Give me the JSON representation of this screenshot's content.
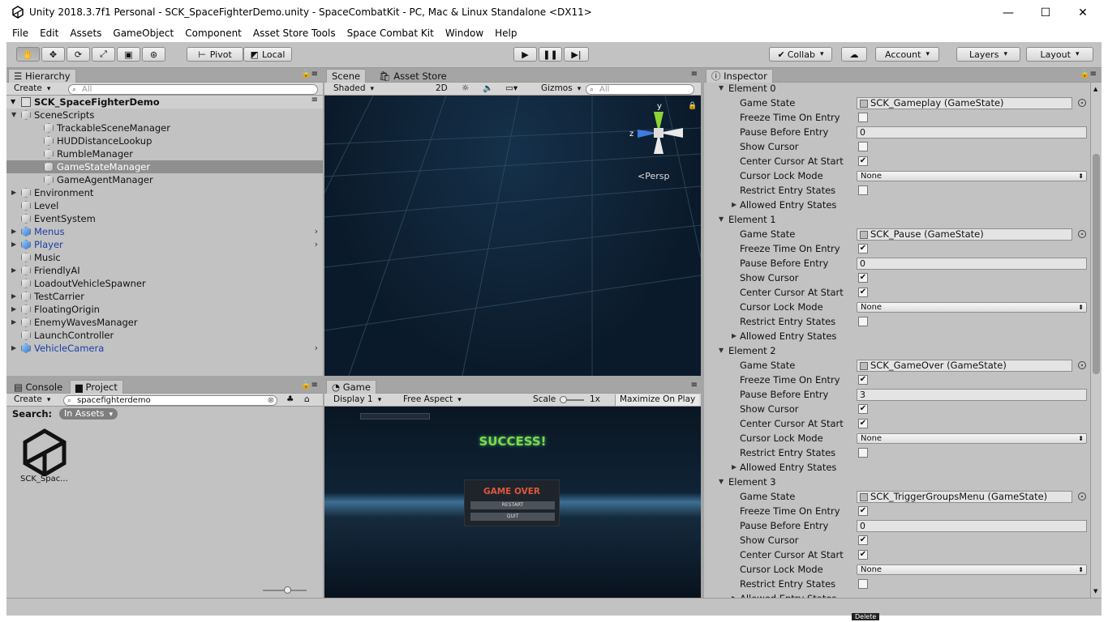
{
  "window": {
    "title": "Unity 2018.3.7f1 Personal - SCK_SpaceFighterDemo.unity - SpaceCombatKit - PC, Mac & Linux Standalone <DX11>",
    "minimize": "—",
    "maximize": "☐",
    "close": "✕"
  },
  "menu": [
    "File",
    "Edit",
    "Assets",
    "GameObject",
    "Component",
    "Asset Store Tools",
    "Space Combat Kit",
    "Window",
    "Help"
  ],
  "toolbar": {
    "pivot": "Pivot",
    "local": "Local",
    "collab": "Collab",
    "account": "Account",
    "layers": "Layers",
    "layout": "Layout"
  },
  "hierarchy": {
    "tab": "Hierarchy",
    "create": "Create",
    "search_placeholder": "All",
    "scene": "SCK_SpaceFighterDemo",
    "items": [
      {
        "label": "SceneScripts",
        "depth": 1,
        "expander": "open",
        "blue": false,
        "selected": false
      },
      {
        "label": "TrackableSceneManager",
        "depth": 2,
        "expander": "",
        "blue": false,
        "selected": false
      },
      {
        "label": "HUDDistanceLookup",
        "depth": 2,
        "expander": "",
        "blue": false,
        "selected": false
      },
      {
        "label": "RumbleManager",
        "depth": 2,
        "expander": "",
        "blue": false,
        "selected": false
      },
      {
        "label": "GameStateManager",
        "depth": 2,
        "expander": "",
        "blue": false,
        "selected": true
      },
      {
        "label": "GameAgentManager",
        "depth": 2,
        "expander": "",
        "blue": false,
        "selected": false
      },
      {
        "label": "Environment",
        "depth": 1,
        "expander": "closed",
        "blue": false,
        "selected": false
      },
      {
        "label": "Level",
        "depth": 1,
        "expander": "",
        "blue": false,
        "selected": false
      },
      {
        "label": "EventSystem",
        "depth": 1,
        "expander": "",
        "blue": false,
        "selected": false
      },
      {
        "label": "Menus",
        "depth": 1,
        "expander": "closed",
        "blue": true,
        "selected": false
      },
      {
        "label": "Player",
        "depth": 1,
        "expander": "closed",
        "blue": true,
        "selected": false
      },
      {
        "label": "Music",
        "depth": 1,
        "expander": "",
        "blue": false,
        "selected": false
      },
      {
        "label": "FriendlyAI",
        "depth": 1,
        "expander": "closed",
        "blue": false,
        "selected": false
      },
      {
        "label": "LoadoutVehicleSpawner",
        "depth": 1,
        "expander": "",
        "blue": false,
        "selected": false
      },
      {
        "label": "TestCarrier",
        "depth": 1,
        "expander": "closed",
        "blue": false,
        "selected": false
      },
      {
        "label": "FloatingOrigin",
        "depth": 1,
        "expander": "closed",
        "blue": false,
        "selected": false
      },
      {
        "label": "EnemyWavesManager",
        "depth": 1,
        "expander": "closed",
        "blue": false,
        "selected": false
      },
      {
        "label": "LaunchController",
        "depth": 1,
        "expander": "",
        "blue": false,
        "selected": false
      },
      {
        "label": "VehicleCamera",
        "depth": 1,
        "expander": "closed",
        "blue": true,
        "selected": false
      }
    ]
  },
  "scene": {
    "tab_scene": "Scene",
    "tab_asset_store": "Asset Store",
    "shaded": "Shaded",
    "mode_2d": "2D",
    "gizmos": "Gizmos",
    "search_placeholder": "All",
    "persp": "Persp",
    "axis_y": "y",
    "axis_z": "z"
  },
  "project": {
    "tab_console": "Console",
    "tab_project": "Project",
    "create": "Create",
    "search_value": "spacefighterdemo",
    "search_label": "Search:",
    "scope": "In Assets",
    "asset_name": "SCK_Spac..."
  },
  "game": {
    "tab": "Game",
    "display": "Display 1",
    "aspect": "Free Aspect",
    "scale_label": "Scale",
    "scale_value": "1x",
    "maximize": "Maximize On Play",
    "success": "SUCCESS!",
    "game_over": "GAME OVER",
    "restart": "RESTART",
    "quit": "QUIT"
  },
  "inspector": {
    "tab": "Inspector",
    "labels": {
      "game_state": "Game State",
      "freeze": "Freeze Time On Entry",
      "pause": "Pause Before Entry",
      "show_cursor": "Show Cursor",
      "center": "Center Cursor At Start",
      "lock": "Cursor Lock Mode",
      "restrict": "Restrict Entry States",
      "allowed": "Allowed Entry States"
    },
    "elements": [
      {
        "title": "Element 0",
        "game_state": "SCK_Gameplay (GameState)",
        "freeze": false,
        "pause": "0",
        "show_cursor": false,
        "center": true,
        "lock": "None",
        "restrict": false
      },
      {
        "title": "Element 1",
        "game_state": "SCK_Pause (GameState)",
        "freeze": true,
        "pause": "0",
        "show_cursor": true,
        "center": true,
        "lock": "None",
        "restrict": false
      },
      {
        "title": "Element 2",
        "game_state": "SCK_GameOver (GameState)",
        "freeze": true,
        "pause": "3",
        "show_cursor": true,
        "center": true,
        "lock": "None",
        "restrict": false
      },
      {
        "title": "Element 3",
        "game_state": "SCK_TriggerGroupsMenu (GameState)",
        "freeze": true,
        "pause": "0",
        "show_cursor": true,
        "center": true,
        "lock": "None",
        "restrict": false
      }
    ]
  },
  "status": {
    "delete": "Delete"
  }
}
